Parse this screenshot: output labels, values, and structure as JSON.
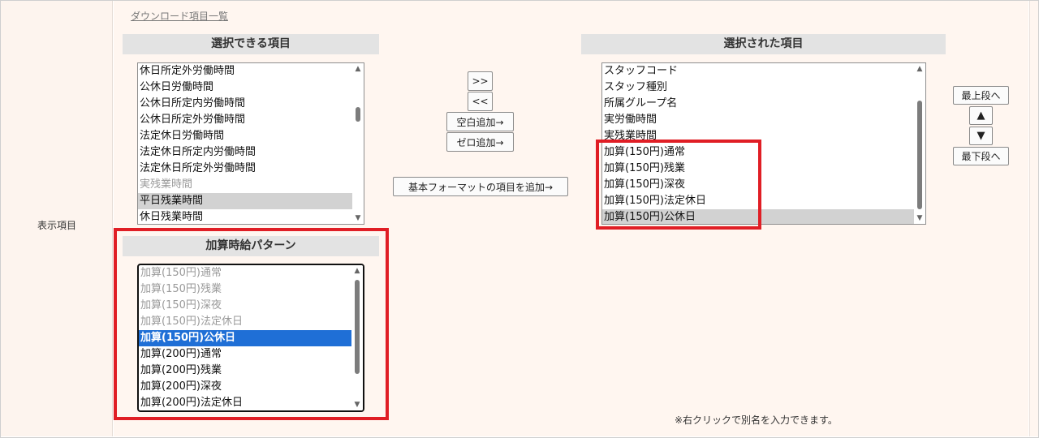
{
  "row_label": "表示項目",
  "download_link": "ダウンロード項目一覧",
  "available": {
    "title": "選択できる項目",
    "items": [
      {
        "label": "休日所定外労働時間",
        "state": "normal"
      },
      {
        "label": "公休日労働時間",
        "state": "normal"
      },
      {
        "label": "公休日所定内労働時間",
        "state": "normal"
      },
      {
        "label": "公休日所定外労働時間",
        "state": "normal"
      },
      {
        "label": "法定休日労働時間",
        "state": "normal"
      },
      {
        "label": "法定休日所定内労働時間",
        "state": "normal"
      },
      {
        "label": "法定休日所定外労働時間",
        "state": "normal"
      },
      {
        "label": "実残業時間",
        "state": "dim"
      },
      {
        "label": "平日残業時間",
        "state": "selected"
      },
      {
        "label": "休日残業時間",
        "state": "normal"
      }
    ]
  },
  "pattern": {
    "title": "加算時給パターン",
    "items": [
      {
        "label": "加算(150円)通常",
        "state": "dim"
      },
      {
        "label": "加算(150円)残業",
        "state": "dim"
      },
      {
        "label": "加算(150円)深夜",
        "state": "dim"
      },
      {
        "label": "加算(150円)法定休日",
        "state": "dim"
      },
      {
        "label": "加算(150円)公休日",
        "state": "highlight"
      },
      {
        "label": "加算(200円)通常",
        "state": "normal"
      },
      {
        "label": "加算(200円)残業",
        "state": "normal"
      },
      {
        "label": "加算(200円)深夜",
        "state": "normal"
      },
      {
        "label": "加算(200円)法定休日",
        "state": "normal"
      }
    ]
  },
  "selected": {
    "title": "選択された項目",
    "items": [
      {
        "label": "スタッフコード",
        "state": "normal"
      },
      {
        "label": "スタッフ種別",
        "state": "normal"
      },
      {
        "label": "所属グループ名",
        "state": "normal"
      },
      {
        "label": "実労働時間",
        "state": "normal"
      },
      {
        "label": "実残業時間",
        "state": "normal"
      },
      {
        "label": "加算(150円)通常",
        "state": "normal"
      },
      {
        "label": "加算(150円)残業",
        "state": "normal"
      },
      {
        "label": "加算(150円)深夜",
        "state": "normal"
      },
      {
        "label": "加算(150円)法定休日",
        "state": "normal"
      },
      {
        "label": "加算(150円)公休日",
        "state": "selected"
      }
    ]
  },
  "buttons": {
    "add": ">>",
    "remove": "<<",
    "add_blank": "空白追加→",
    "add_zero": "ゼロ追加→",
    "add_basic_format": "基本フォーマットの項目を追加→",
    "move_top": "最上段へ",
    "move_up": "▲",
    "move_down": "▼",
    "move_bottom": "最下段へ"
  },
  "note": "※右クリックで別名を入力できます。",
  "colors": {
    "highlight_box": "#e01e25",
    "selection_blue": "#1f6fd6",
    "selection_gray": "#d2d2d2",
    "panel_bg": "#fff6f0"
  }
}
